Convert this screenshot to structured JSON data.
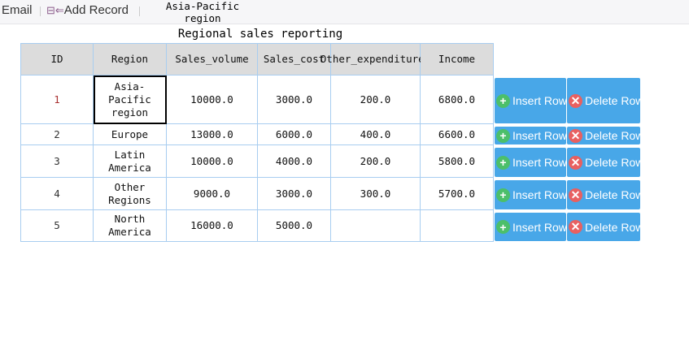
{
  "toolbar": {
    "email": "Email",
    "add_record": "Add Record",
    "cell_preview": "Asia-Pacific region"
  },
  "title": "Regional sales reporting",
  "columns": [
    "ID",
    "Region",
    "Sales_volume",
    "Sales_cost",
    "Other_expenditures",
    "Income"
  ],
  "rows": [
    [
      "1",
      "Asia-Pacific region",
      "10000.0",
      "3000.0",
      "200.0",
      "6800.0"
    ],
    [
      "2",
      "Europe",
      "13000.0",
      "6000.0",
      "400.0",
      "6600.0"
    ],
    [
      "3",
      "Latin America",
      "10000.0",
      "4000.0",
      "200.0",
      "5800.0"
    ],
    [
      "4",
      "Other Regions",
      "9000.0",
      "3000.0",
      "300.0",
      "5700.0"
    ],
    [
      "5",
      "North America",
      "16000.0",
      "5000.0",
      "",
      ""
    ]
  ],
  "actions": {
    "insert": "Insert Row",
    "delete": "Delete Row"
  },
  "colors": {
    "button": "#48a7e8",
    "insert_icon": "#4cbf6a",
    "delete_icon": "#e86060"
  }
}
